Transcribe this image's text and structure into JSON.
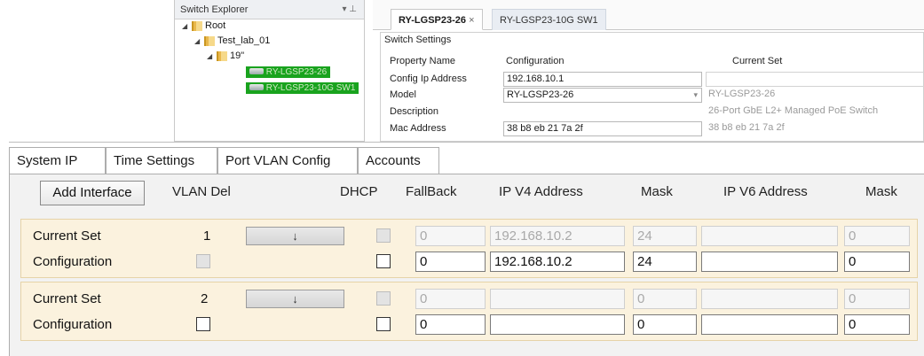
{
  "explorer": {
    "title": "Switch Explorer",
    "pins": "▾ ⊥",
    "tree": {
      "root": "Root",
      "lab": "Test_lab_01",
      "rack": "19\"",
      "switch1": "RY-LGSP23-26",
      "switch2": "RY-LGSP23-10G SW1"
    }
  },
  "panel_tabs": {
    "active": "RY-LGSP23-26",
    "close_glyph": "×",
    "inactive": "RY-LGSP23-10G SW1"
  },
  "switch_settings": {
    "title": "Switch Settings",
    "col_property": "Property Name",
    "col_config": "Configuration",
    "col_current": "Current Set",
    "rows": {
      "config_ip": {
        "label": "Config Ip Address",
        "config": "192.168.10.1",
        "current": ""
      },
      "model": {
        "label": "Model",
        "config": "RY-LGSP23-26",
        "current": "RY-LGSP23-26"
      },
      "description": {
        "label": "Description",
        "config": "",
        "current": "26-Port GbE L2+ Managed PoE Switch"
      },
      "mac": {
        "label": "Mac Address",
        "config": "38 b8 eb 21 7a 2f",
        "current": "38 b8 eb 21 7a 2f"
      }
    }
  },
  "dialog": {
    "tabs": [
      "System IP",
      "Time Settings",
      "Port VLAN Config",
      "Accounts"
    ],
    "add_interface": "Add Interface",
    "headers": {
      "vlan": "VLAN Del",
      "dhcp": "DHCP",
      "fallback": "FallBack",
      "ipv4": "IP V4 Address",
      "mask4": "Mask",
      "ipv6": "IP V6 Address",
      "mask6": "Mask"
    },
    "groups": [
      {
        "current": {
          "label": "Current Set",
          "vlan": "1",
          "button": "↓",
          "fallback": "0",
          "ipv4": "192.168.10.2",
          "mask4": "24",
          "ipv6": "",
          "mask6": "0"
        },
        "config": {
          "label": "Configuration",
          "fallback": "0",
          "ipv4": "192.168.10.2",
          "mask4": "24",
          "ipv6": "",
          "mask6": "0"
        }
      },
      {
        "current": {
          "label": "Current Set",
          "vlan": "2",
          "button": "↓",
          "fallback": "0",
          "ipv4": "",
          "mask4": "0",
          "ipv6": "",
          "mask6": "0"
        },
        "config": {
          "label": "Configuration",
          "fallback": "0",
          "ipv4": "",
          "mask4": "0",
          "ipv6": "",
          "mask6": "0"
        }
      }
    ]
  },
  "colors": {
    "selected_node": "#19a31e",
    "group_background": "#fbf2de",
    "dialog_background": "#f2f2f2"
  }
}
